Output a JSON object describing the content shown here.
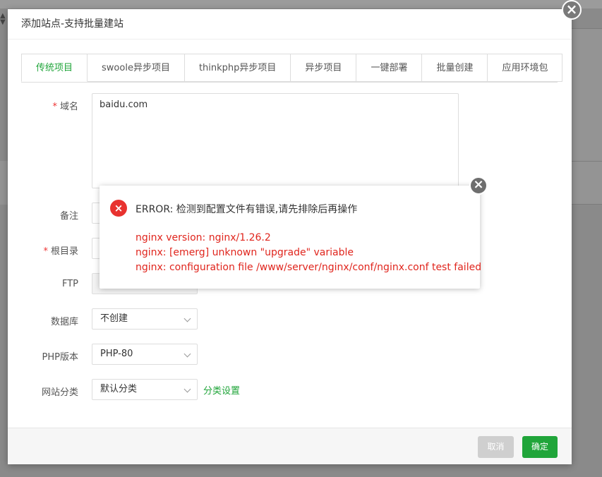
{
  "dialog": {
    "title": "添加站点-支持批量建站",
    "close_icon": "×"
  },
  "tabs": [
    {
      "label": "传统项目",
      "active": true
    },
    {
      "label": "swoole异步项目"
    },
    {
      "label": "thinkphp异步项目"
    },
    {
      "label": "异步项目"
    },
    {
      "label": "一键部署"
    },
    {
      "label": "批量创建"
    },
    {
      "label": "应用环境包"
    }
  ],
  "form": {
    "domain_label": "域名",
    "domain_value": "baidu.com",
    "remark_label": "备注",
    "root_label": "根目录",
    "ftp_label": "FTP",
    "db_label": "数据库",
    "db_value": "不创建",
    "php_label": "PHP版本",
    "php_value": "PHP-80",
    "category_label": "网站分类",
    "category_value": "默认分类",
    "category_link": "分类设置",
    "required_mark": "*"
  },
  "footer": {
    "cancel_label": "取消",
    "ok_label": "确定"
  },
  "error": {
    "icon": "×",
    "title": "ERROR: 检测到配置文件有错误,请先排除后再操作",
    "lines": [
      "nginx version: nginx/1.26.2",
      "nginx: [emerg] unknown \"upgrade\" variable",
      "nginx: configuration file /www/server/nginx/conf/nginx.conf test failed"
    ],
    "close_icon": "×"
  },
  "colors": {
    "accent": "#20a53a",
    "error": "#e0251d",
    "error_icon": "#e8322f"
  }
}
